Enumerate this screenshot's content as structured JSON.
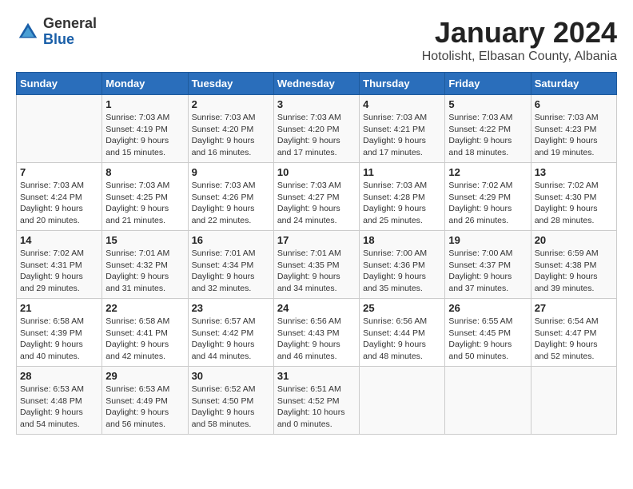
{
  "header": {
    "logo": {
      "general": "General",
      "blue": "Blue"
    },
    "month_title": "January 2024",
    "subtitle": "Hotolisht, Elbasan County, Albania"
  },
  "weekdays": [
    "Sunday",
    "Monday",
    "Tuesday",
    "Wednesday",
    "Thursday",
    "Friday",
    "Saturday"
  ],
  "weeks": [
    [
      {
        "day": "",
        "sunrise": "",
        "sunset": "",
        "daylight": ""
      },
      {
        "day": "1",
        "sunrise": "Sunrise: 7:03 AM",
        "sunset": "Sunset: 4:19 PM",
        "daylight": "Daylight: 9 hours and 15 minutes."
      },
      {
        "day": "2",
        "sunrise": "Sunrise: 7:03 AM",
        "sunset": "Sunset: 4:20 PM",
        "daylight": "Daylight: 9 hours and 16 minutes."
      },
      {
        "day": "3",
        "sunrise": "Sunrise: 7:03 AM",
        "sunset": "Sunset: 4:20 PM",
        "daylight": "Daylight: 9 hours and 17 minutes."
      },
      {
        "day": "4",
        "sunrise": "Sunrise: 7:03 AM",
        "sunset": "Sunset: 4:21 PM",
        "daylight": "Daylight: 9 hours and 17 minutes."
      },
      {
        "day": "5",
        "sunrise": "Sunrise: 7:03 AM",
        "sunset": "Sunset: 4:22 PM",
        "daylight": "Daylight: 9 hours and 18 minutes."
      },
      {
        "day": "6",
        "sunrise": "Sunrise: 7:03 AM",
        "sunset": "Sunset: 4:23 PM",
        "daylight": "Daylight: 9 hours and 19 minutes."
      }
    ],
    [
      {
        "day": "7",
        "sunrise": "Sunrise: 7:03 AM",
        "sunset": "Sunset: 4:24 PM",
        "daylight": "Daylight: 9 hours and 20 minutes."
      },
      {
        "day": "8",
        "sunrise": "Sunrise: 7:03 AM",
        "sunset": "Sunset: 4:25 PM",
        "daylight": "Daylight: 9 hours and 21 minutes."
      },
      {
        "day": "9",
        "sunrise": "Sunrise: 7:03 AM",
        "sunset": "Sunset: 4:26 PM",
        "daylight": "Daylight: 9 hours and 22 minutes."
      },
      {
        "day": "10",
        "sunrise": "Sunrise: 7:03 AM",
        "sunset": "Sunset: 4:27 PM",
        "daylight": "Daylight: 9 hours and 24 minutes."
      },
      {
        "day": "11",
        "sunrise": "Sunrise: 7:03 AM",
        "sunset": "Sunset: 4:28 PM",
        "daylight": "Daylight: 9 hours and 25 minutes."
      },
      {
        "day": "12",
        "sunrise": "Sunrise: 7:02 AM",
        "sunset": "Sunset: 4:29 PM",
        "daylight": "Daylight: 9 hours and 26 minutes."
      },
      {
        "day": "13",
        "sunrise": "Sunrise: 7:02 AM",
        "sunset": "Sunset: 4:30 PM",
        "daylight": "Daylight: 9 hours and 28 minutes."
      }
    ],
    [
      {
        "day": "14",
        "sunrise": "Sunrise: 7:02 AM",
        "sunset": "Sunset: 4:31 PM",
        "daylight": "Daylight: 9 hours and 29 minutes."
      },
      {
        "day": "15",
        "sunrise": "Sunrise: 7:01 AM",
        "sunset": "Sunset: 4:32 PM",
        "daylight": "Daylight: 9 hours and 31 minutes."
      },
      {
        "day": "16",
        "sunrise": "Sunrise: 7:01 AM",
        "sunset": "Sunset: 4:34 PM",
        "daylight": "Daylight: 9 hours and 32 minutes."
      },
      {
        "day": "17",
        "sunrise": "Sunrise: 7:01 AM",
        "sunset": "Sunset: 4:35 PM",
        "daylight": "Daylight: 9 hours and 34 minutes."
      },
      {
        "day": "18",
        "sunrise": "Sunrise: 7:00 AM",
        "sunset": "Sunset: 4:36 PM",
        "daylight": "Daylight: 9 hours and 35 minutes."
      },
      {
        "day": "19",
        "sunrise": "Sunrise: 7:00 AM",
        "sunset": "Sunset: 4:37 PM",
        "daylight": "Daylight: 9 hours and 37 minutes."
      },
      {
        "day": "20",
        "sunrise": "Sunrise: 6:59 AM",
        "sunset": "Sunset: 4:38 PM",
        "daylight": "Daylight: 9 hours and 39 minutes."
      }
    ],
    [
      {
        "day": "21",
        "sunrise": "Sunrise: 6:58 AM",
        "sunset": "Sunset: 4:39 PM",
        "daylight": "Daylight: 9 hours and 40 minutes."
      },
      {
        "day": "22",
        "sunrise": "Sunrise: 6:58 AM",
        "sunset": "Sunset: 4:41 PM",
        "daylight": "Daylight: 9 hours and 42 minutes."
      },
      {
        "day": "23",
        "sunrise": "Sunrise: 6:57 AM",
        "sunset": "Sunset: 4:42 PM",
        "daylight": "Daylight: 9 hours and 44 minutes."
      },
      {
        "day": "24",
        "sunrise": "Sunrise: 6:56 AM",
        "sunset": "Sunset: 4:43 PM",
        "daylight": "Daylight: 9 hours and 46 minutes."
      },
      {
        "day": "25",
        "sunrise": "Sunrise: 6:56 AM",
        "sunset": "Sunset: 4:44 PM",
        "daylight": "Daylight: 9 hours and 48 minutes."
      },
      {
        "day": "26",
        "sunrise": "Sunrise: 6:55 AM",
        "sunset": "Sunset: 4:45 PM",
        "daylight": "Daylight: 9 hours and 50 minutes."
      },
      {
        "day": "27",
        "sunrise": "Sunrise: 6:54 AM",
        "sunset": "Sunset: 4:47 PM",
        "daylight": "Daylight: 9 hours and 52 minutes."
      }
    ],
    [
      {
        "day": "28",
        "sunrise": "Sunrise: 6:53 AM",
        "sunset": "Sunset: 4:48 PM",
        "daylight": "Daylight: 9 hours and 54 minutes."
      },
      {
        "day": "29",
        "sunrise": "Sunrise: 6:53 AM",
        "sunset": "Sunset: 4:49 PM",
        "daylight": "Daylight: 9 hours and 56 minutes."
      },
      {
        "day": "30",
        "sunrise": "Sunrise: 6:52 AM",
        "sunset": "Sunset: 4:50 PM",
        "daylight": "Daylight: 9 hours and 58 minutes."
      },
      {
        "day": "31",
        "sunrise": "Sunrise: 6:51 AM",
        "sunset": "Sunset: 4:52 PM",
        "daylight": "Daylight: 10 hours and 0 minutes."
      },
      {
        "day": "",
        "sunrise": "",
        "sunset": "",
        "daylight": ""
      },
      {
        "day": "",
        "sunrise": "",
        "sunset": "",
        "daylight": ""
      },
      {
        "day": "",
        "sunrise": "",
        "sunset": "",
        "daylight": ""
      }
    ]
  ]
}
